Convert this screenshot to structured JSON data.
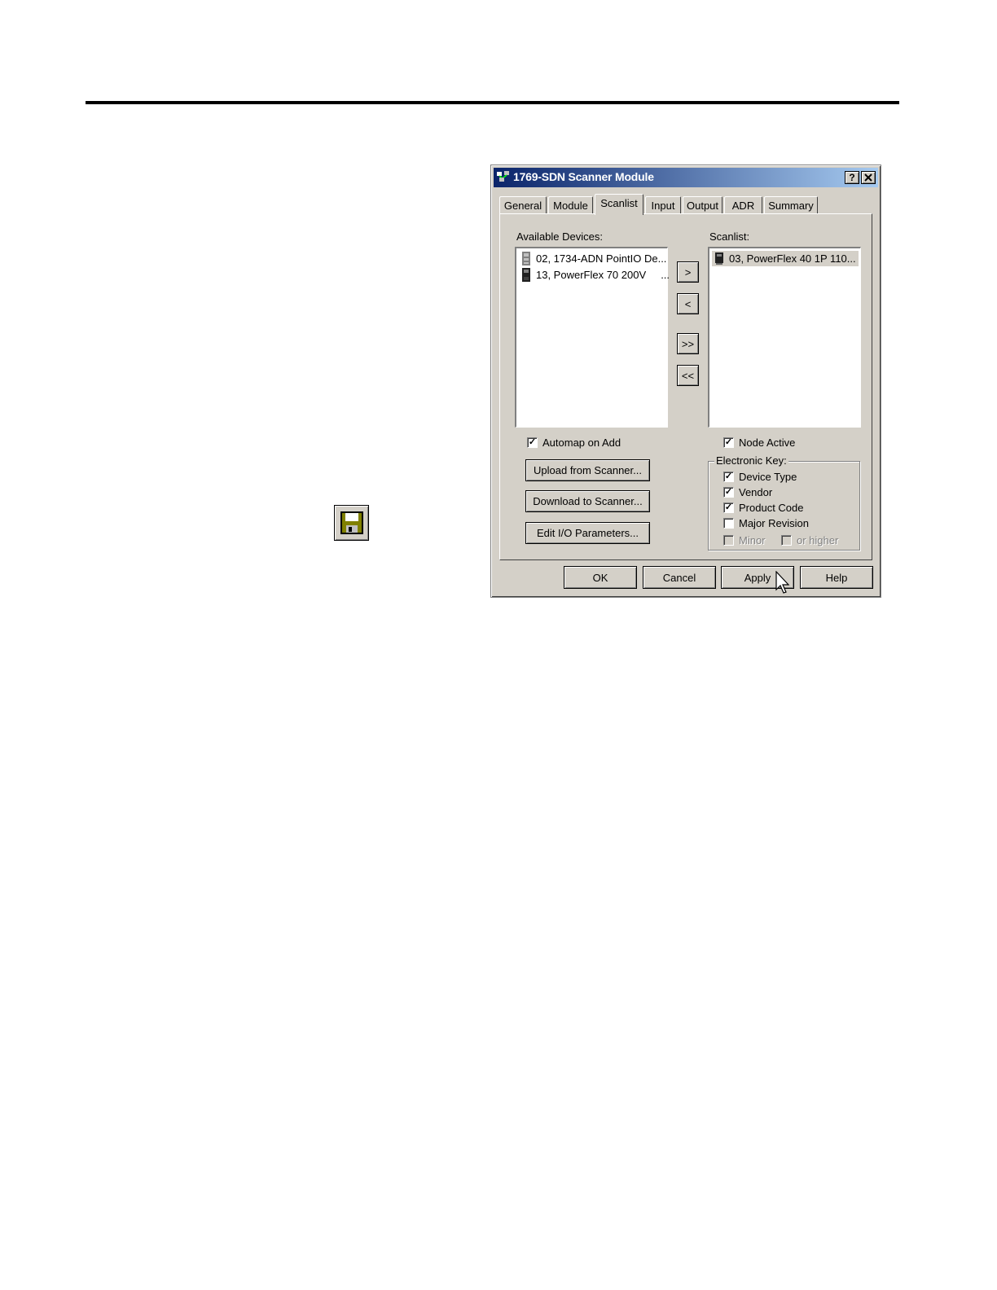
{
  "dialog": {
    "title": "1769-SDN Scanner Module",
    "help_button": "?",
    "close_button": "✕"
  },
  "tabs": [
    {
      "label": "General"
    },
    {
      "label": "Module"
    },
    {
      "label": "Scanlist"
    },
    {
      "label": "Input"
    },
    {
      "label": "Output"
    },
    {
      "label": "ADR"
    },
    {
      "label": "Summary"
    }
  ],
  "active_tab": "Scanlist",
  "available": {
    "label": "Available Devices:",
    "items": [
      {
        "text": "02, 1734-ADN PointIO De..."
      },
      {
        "text": "13, PowerFlex 70 200V     ..."
      }
    ]
  },
  "scanlist": {
    "label": "Scanlist:",
    "items": [
      {
        "text": "03, PowerFlex 40 1P 110..."
      }
    ]
  },
  "move": {
    "add": ">",
    "remove": "<",
    "add_all": ">>",
    "remove_all": "<<"
  },
  "automap": {
    "label": "Automap on Add",
    "checked": true
  },
  "node_active": {
    "label": "Node Active",
    "checked": true
  },
  "actions": {
    "upload": "Upload from Scanner...",
    "download": "Download to Scanner...",
    "edit_io": "Edit I/O Parameters..."
  },
  "electronic_key": {
    "title": "Electronic Key:",
    "device_type": {
      "label": "Device Type",
      "checked": true
    },
    "vendor": {
      "label": "Vendor",
      "checked": true
    },
    "product_code": {
      "label": "Product Code",
      "checked": true
    },
    "major_revision": {
      "label": "Major Revision",
      "checked": false
    },
    "minor": {
      "label": "Minor",
      "checked": false
    },
    "or_higher": {
      "label": "or higher",
      "checked": false
    }
  },
  "footer": {
    "ok": "OK",
    "cancel": "Cancel",
    "apply": "Apply",
    "help": "Help"
  }
}
